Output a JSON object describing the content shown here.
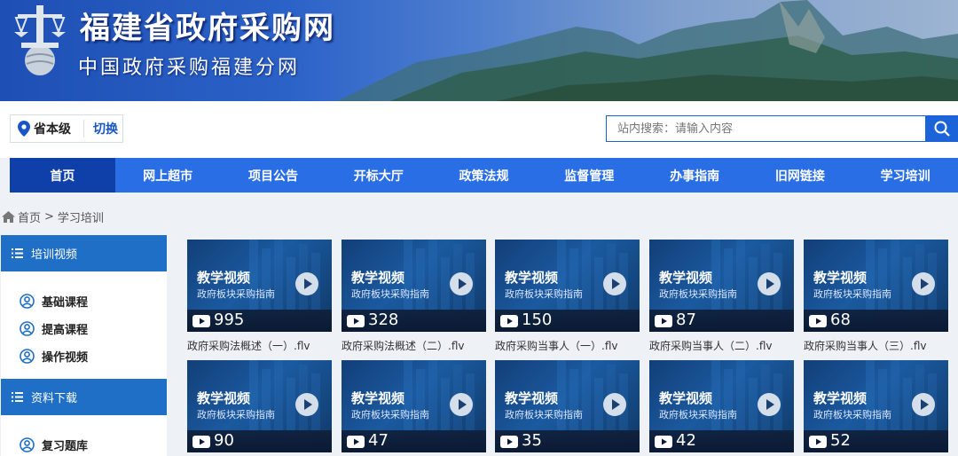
{
  "header": {
    "site_title": "福建省政府采购网",
    "site_subtitle": "中国政府采购福建分网"
  },
  "region": {
    "level": "省本级",
    "switch_label": "切换"
  },
  "search": {
    "placeholder": "站内搜索：请输入内容"
  },
  "nav": {
    "items": [
      "首页",
      "网上超市",
      "项目公告",
      "开标大厅",
      "政策法规",
      "监督管理",
      "办事指南",
      "旧网链接",
      "学习培训"
    ],
    "active_index": 0
  },
  "breadcrumb": {
    "home": "首页",
    "separator": ">",
    "current": "学习培训"
  },
  "sidebar": {
    "sections": [
      {
        "title": "培训视频",
        "items": [
          "基础课程",
          "提高课程",
          "操作视频"
        ]
      },
      {
        "title": "资料下载",
        "items": [
          "复习题库"
        ]
      }
    ]
  },
  "videos": {
    "thumb_title": "教学视频",
    "thumb_subtitle": "政府板块采购指南",
    "items": [
      {
        "count": "995",
        "caption": "政府采购法概述（一）.flv"
      },
      {
        "count": "328",
        "caption": "政府采购法概述（二）.flv"
      },
      {
        "count": "150",
        "caption": "政府采购当事人（一）.flv"
      },
      {
        "count": "87",
        "caption": "政府采购当事人（二）.flv"
      },
      {
        "count": "68",
        "caption": "政府采购当事人（三）.flv"
      },
      {
        "count": "90",
        "caption": ""
      },
      {
        "count": "47",
        "caption": ""
      },
      {
        "count": "35",
        "caption": ""
      },
      {
        "count": "42",
        "caption": ""
      },
      {
        "count": "52",
        "caption": ""
      }
    ]
  },
  "colors": {
    "nav_bg": "#2a6ee6",
    "nav_active": "#0f3fa8",
    "sidebar_head": "#1f6fc7",
    "accent": "#1a55c8"
  }
}
